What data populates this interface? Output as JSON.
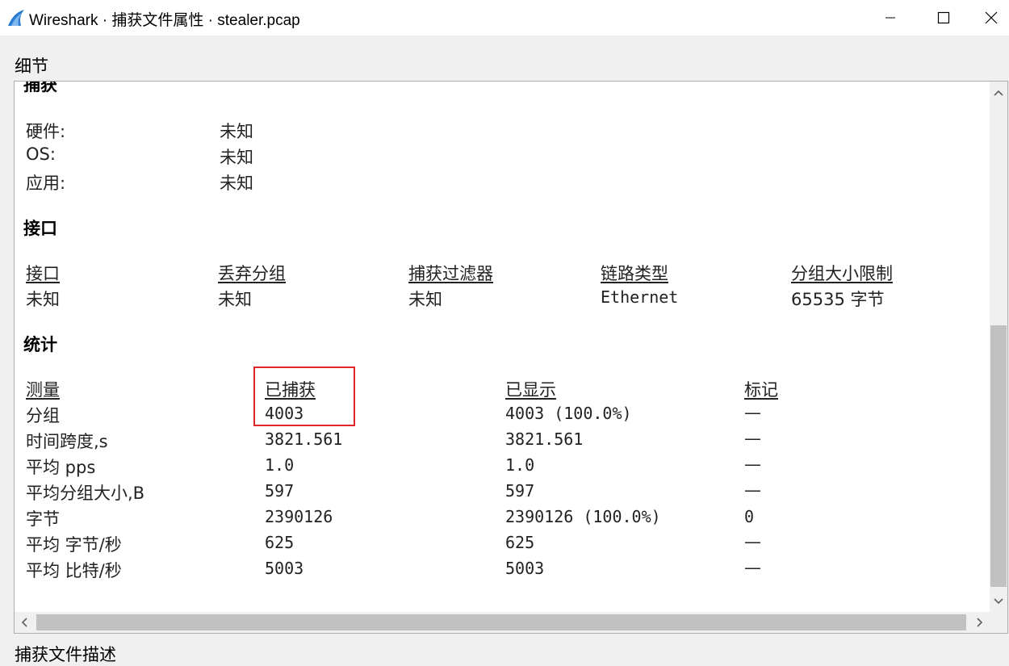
{
  "window": {
    "title": "Wireshark · 捕获文件属性 · stealer.pcap",
    "icon": "wireshark-fin-icon",
    "controls": [
      "minimize-icon",
      "maximize-icon",
      "close-icon"
    ]
  },
  "details_label": "细节",
  "description_label": "捕获文件描述",
  "capture": {
    "heading": "捕获",
    "rows": [
      {
        "label": "硬件:",
        "value": "未知"
      },
      {
        "label": "OS:",
        "value": "未知"
      },
      {
        "label": "应用:",
        "value": "未知"
      }
    ]
  },
  "interfaces": {
    "heading": "接口",
    "headers": [
      "接口",
      "丢弃分组",
      "捕获过滤器",
      "链路类型",
      "分组大小限制"
    ],
    "row": [
      "未知",
      "未知",
      "未知",
      "Ethernet",
      "65535 字节"
    ]
  },
  "statistics": {
    "heading": "统计",
    "headers": [
      "测量",
      "已捕获",
      "已显示",
      "标记"
    ],
    "rows": [
      [
        "分组",
        "4003",
        "4003 (100.0%)",
        "—"
      ],
      [
        "时间跨度,s",
        "3821.561",
        "3821.561",
        "—"
      ],
      [
        "平均 pps",
        "1.0",
        "1.0",
        "—"
      ],
      [
        "平均分组大小,B",
        "597",
        "597",
        "—"
      ],
      [
        "字节",
        "2390126",
        "2390126 (100.0%)",
        "0"
      ],
      [
        "平均 字节/秒",
        "625",
        "625",
        "—"
      ],
      [
        "平均 比特/秒",
        "5003",
        "5003",
        "—"
      ]
    ]
  },
  "colors": {
    "highlight_border": "#e0262a",
    "icon_blue": "#2a7bd4"
  }
}
